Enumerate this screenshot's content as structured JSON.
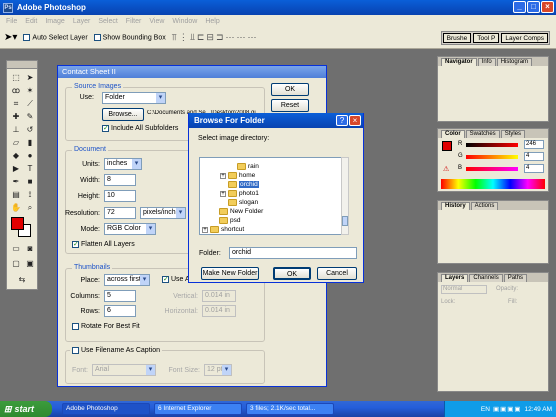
{
  "app": {
    "title": "Adobe Photoshop"
  },
  "menu": [
    "File",
    "Edit",
    "Image",
    "Layer",
    "Select",
    "Filter",
    "View",
    "Window",
    "Help"
  ],
  "options_bar": {
    "auto_select": "Auto Select Layer",
    "bounding_box": "Show Bounding Box",
    "palette_well": [
      "Brushe",
      "Tool P",
      "Layer Comps"
    ]
  },
  "contact_sheet": {
    "title": "Contact Sheet II",
    "source_images": {
      "legend": "Source Images",
      "use_label": "Use:",
      "use_value": "Folder",
      "browse": "Browse...",
      "path": "C:\\Documents and Se...\\Desktop\\2008 gi",
      "include_subfolders": "Include All Subfolders"
    },
    "document": {
      "legend": "Document",
      "units_label": "Units:",
      "units_value": "inches",
      "width_label": "Width:",
      "width_value": "8",
      "height_label": "Height:",
      "height_value": "10",
      "resolution_label": "Resolution:",
      "resolution_value": "72",
      "resolution_unit": "pixels/inch",
      "mode_label": "Mode:",
      "mode_value": "RGB Color",
      "flatten": "Flatten All Layers"
    },
    "thumbnails": {
      "legend": "Thumbnails",
      "place_label": "Place:",
      "place_value": "across first",
      "use_auto": "Use A",
      "columns_label": "Columns:",
      "columns_value": "5",
      "rows_label": "Rows:",
      "rows_value": "6",
      "vertical_label": "Vertical:",
      "vertical_value": "0.014 in",
      "horizontal_label": "Horizontal:",
      "horizontal_value": "0.014 in",
      "rotate": "Rotate For Best Fit"
    },
    "caption": {
      "use_caption": "Use Filename As Caption",
      "font_label": "Font:",
      "font_value": "Arial",
      "size_label": "Font Size:",
      "size_value": "12 pt"
    },
    "ok": "OK",
    "reset": "Reset"
  },
  "browse_dialog": {
    "title": "Browse For Folder",
    "prompt": "Select image directory:",
    "tree": [
      {
        "name": "rain",
        "level": 3,
        "expander": ""
      },
      {
        "name": "home",
        "level": 2,
        "expander": "+"
      },
      {
        "name": "orchid",
        "level": 2,
        "expander": "",
        "selected": true
      },
      {
        "name": "photo1",
        "level": 2,
        "expander": "+"
      },
      {
        "name": "slogan",
        "level": 2,
        "expander": ""
      },
      {
        "name": "New Folder",
        "level": 1,
        "expander": ""
      },
      {
        "name": "psd",
        "level": 1,
        "expander": ""
      },
      {
        "name": "shortcut",
        "level": 0,
        "expander": "+"
      }
    ],
    "folder_label": "Folder:",
    "folder_value": "orchid",
    "make_new": "Make New Folder",
    "ok": "OK",
    "cancel": "Cancel"
  },
  "panels": {
    "navigator": [
      "Navigator",
      "Info",
      "Histogram"
    ],
    "color": [
      "Color",
      "Swatches",
      "Styles"
    ],
    "color_values": {
      "r": "246",
      "g": "4",
      "b": "4"
    },
    "color_labels": {
      "r": "R",
      "g": "G",
      "b": "B"
    },
    "history": [
      "History",
      "Actions"
    ],
    "layers": [
      "Layers",
      "Channels",
      "Paths"
    ],
    "layers_mode": "Normal",
    "opacity_label": "Opacity:",
    "lock_label": "Lock:",
    "fill_label": "Fill:"
  },
  "taskbar": {
    "start": "start",
    "tasks": [
      "Adobe Photoshop",
      "6 Internet Explorer",
      "3 files; 2.1K/sec total..."
    ],
    "lang": "EN",
    "clock": "12:49 AM"
  },
  "colors": {
    "titlebar": "#0a5fd8",
    "foreground_swatch": "#e00000",
    "selection": "#316ac5"
  }
}
